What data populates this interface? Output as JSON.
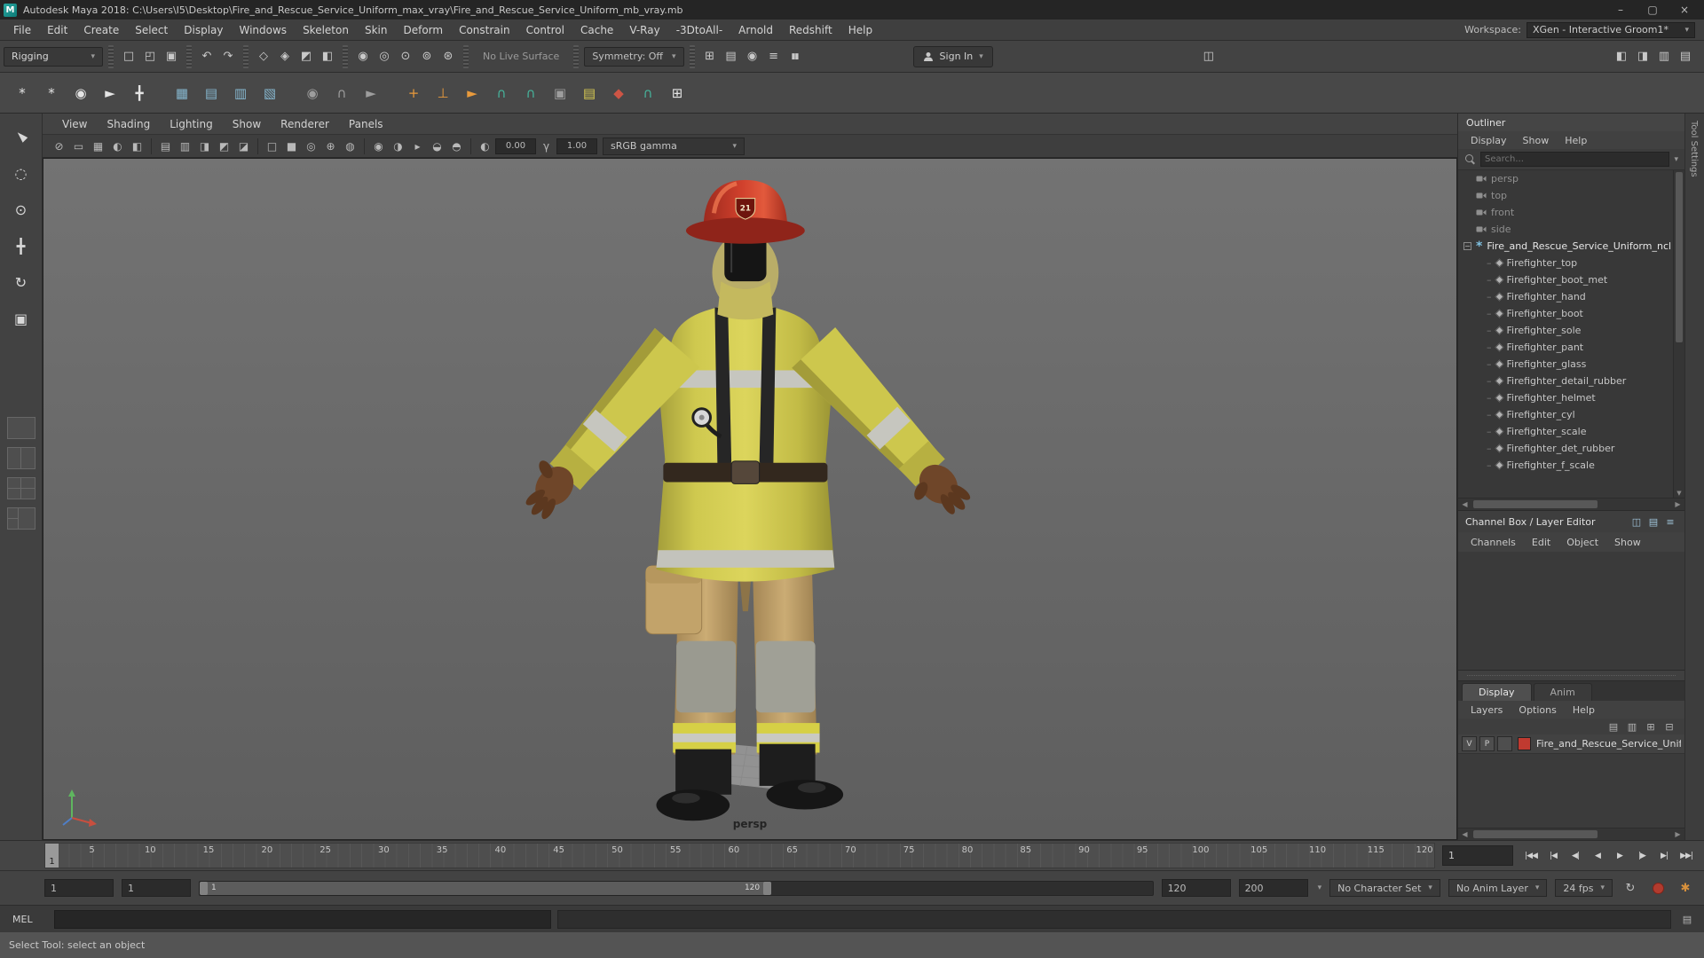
{
  "window": {
    "title": "Autodesk Maya 2018: C:\\Users\\I5\\Desktop\\Fire_and_Rescue_Service_Uniform_max_vray\\Fire_and_Rescue_Service_Uniform_mb_vray.mb"
  },
  "menubar": {
    "items": [
      "File",
      "Edit",
      "Create",
      "Select",
      "Display",
      "Windows",
      "Skeleton",
      "Skin",
      "Deform",
      "Constrain",
      "Control",
      "Cache",
      "V-Ray",
      "-3DtoAll-",
      "Arnold",
      "Redshift",
      "Help"
    ],
    "workspace_label": "Workspace:",
    "workspace_value": "XGen - Interactive Groom1*"
  },
  "statusline": {
    "menu_set": "Rigging",
    "no_live_surface": "No Live Surface",
    "symmetry": "Symmetry: Off",
    "sign_in": "Sign In"
  },
  "shelf": {
    "tiles": [
      "*",
      "*",
      "◉",
      "►",
      "╋",
      "▦",
      "▤",
      "▥",
      "▧",
      "◉",
      "∩",
      "►",
      "+",
      "⊥",
      "►",
      "∩",
      "∩",
      "▣",
      "▤",
      "◆",
      "∩",
      "⊞"
    ]
  },
  "toolbox": {
    "tools": [
      "►",
      "◌",
      "⊙",
      "╋",
      "↻",
      "▣"
    ]
  },
  "panel_bar": {
    "menus": [
      "View",
      "Shading",
      "Lighting",
      "Show",
      "Renderer",
      "Panels"
    ],
    "icons": [
      "⊘",
      "▭",
      "▦",
      "◐",
      "◧",
      "▤",
      "▥",
      "◨",
      "◩",
      "◪",
      "□",
      "■",
      "◎",
      "⊕",
      "◍",
      "◉",
      "◑",
      "▸",
      "◒",
      "◓"
    ],
    "exposure_icon": "◐",
    "exposure": "0.00",
    "gamma_icon": "γ",
    "gamma": "1.00",
    "view_transform": "sRGB gamma"
  },
  "viewport": {
    "camera_label": "persp",
    "helmet_badge": "21"
  },
  "outliner": {
    "title": "Outliner",
    "menus": [
      "Display",
      "Show",
      "Help"
    ],
    "search_placeholder": "Search...",
    "cameras": [
      "persp",
      "top",
      "front",
      "side"
    ],
    "root_item": "Fire_and_Rescue_Service_Uniform_ncl",
    "children": [
      "Firefighter_top",
      "Firefighter_boot_met",
      "Firefighter_hand",
      "Firefighter_boot",
      "Firefighter_sole",
      "Firefighter_pant",
      "Firefighter_glass",
      "Firefighter_detail_rubber",
      "Firefighter_helmet",
      "Firefighter_cyl",
      "Firefighter_scale",
      "Firefighter_det_rubber",
      "Firefighter_f_scale"
    ]
  },
  "channel_box": {
    "title": "Channel Box / Layer Editor",
    "menus": [
      "Channels",
      "Edit",
      "Object",
      "Show"
    ],
    "icons": [
      "◫",
      "▤",
      "≡"
    ]
  },
  "layer_editor": {
    "tabs": [
      "Display",
      "Anim"
    ],
    "menus": [
      "Layers",
      "Options",
      "Help"
    ],
    "icons": [
      "▤",
      "▥",
      "⊞",
      "⊟"
    ],
    "layer": {
      "visible": "V",
      "playback": "P",
      "name": "Fire_and_Rescue_Service_Unifo"
    }
  },
  "side_tab": "Tool Settings",
  "timeline": {
    "ticks": [
      "5",
      "10",
      "15",
      "20",
      "25",
      "30",
      "35",
      "40",
      "45",
      "50",
      "55",
      "60",
      "65",
      "70",
      "75",
      "80",
      "85",
      "90",
      "95",
      "100",
      "105",
      "110",
      "115",
      "120"
    ],
    "playhead": "1",
    "current_time": "1"
  },
  "range_slider": {
    "anim_start": "1",
    "playback_start": "1",
    "range_label_start": "1",
    "range_label_end": "120",
    "playback_end": "120",
    "anim_end": "200",
    "character_set": "No Character Set",
    "anim_layer": "No Anim Layer",
    "fps": "24 fps"
  },
  "command_line": {
    "label": "MEL"
  },
  "help_line": {
    "text": "Select Tool: select an object"
  },
  "colors": {
    "accent": "#5285a6",
    "layer_swatch": "#c03a30",
    "helmet_red": "#c5392b",
    "jacket_yellow": "#d2cb4e",
    "pants_tan": "#c2a36d"
  },
  "icons": {
    "maya_logo": "M",
    "minimize": "–",
    "maximize": "▢",
    "close": "×",
    "caret": "▾",
    "file": [
      "□",
      "◰",
      "▣"
    ],
    "edit": [
      "↶",
      "↷"
    ],
    "masks": [
      "◇",
      "◈",
      "◩",
      "◧"
    ],
    "snap": [
      "◉",
      "◎",
      "⊙",
      "⊚",
      "⊛"
    ],
    "history": [
      "⊞",
      "⊟",
      "▤",
      "◉",
      "≡"
    ],
    "pause": "▮▮",
    "cube": "◫",
    "panel_toggles": [
      "◧",
      "◨",
      "▥",
      "▤"
    ],
    "collapse": "−",
    "tree_dash": "–",
    "node_star": "*",
    "scroll_left": "◀",
    "scroll_right": "▶",
    "scroll_down": "▼",
    "playback": [
      "|◀◀",
      "|◀",
      "◀|",
      "◀",
      "▶",
      "|▶",
      "▶|",
      "▶▶|"
    ],
    "loop": "↻",
    "script_editor": "▤"
  }
}
